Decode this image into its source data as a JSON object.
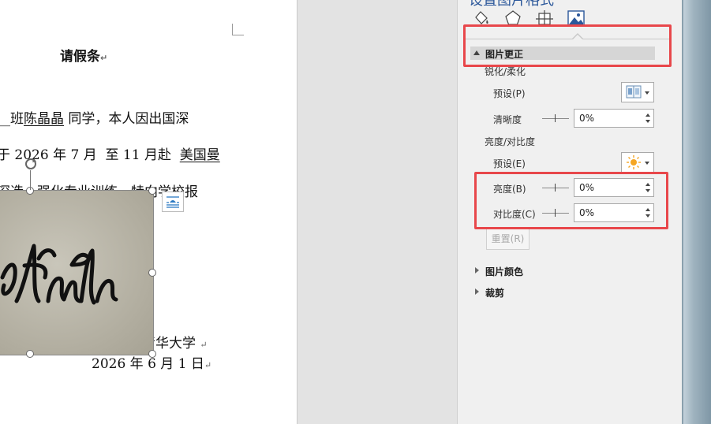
{
  "document": {
    "title": "请假条",
    "line1": {
      "lead": "__班",
      "name": "陈晶晶",
      "rest": "同学，本人因出国深"
    },
    "line2": {
      "prefix": "于 2026 年 7 月  至 11 月赴",
      "place": "美国曼"
    },
    "line3": "深造，强化专业训练，特向学校报",
    "signature_org": "清华大学",
    "date": "2026 年 6 月 1 日"
  },
  "pane": {
    "title": "设置图片格式",
    "tabs": [
      {
        "name": "fill-line",
        "icon": "paint-bucket-icon"
      },
      {
        "name": "effects",
        "icon": "pentagon-icon"
      },
      {
        "name": "layout-properties",
        "icon": "layout-size-icon"
      },
      {
        "name": "picture",
        "icon": "picture-icon",
        "active": true
      }
    ],
    "correction": {
      "header": "图片更正",
      "sharpen_group": "锐化/柔化",
      "sharpen_preset_label": "预设(P)",
      "sharpness_label": "清晰度",
      "sharpness_value": "0%",
      "bc_group": "亮度/对比度",
      "bc_preset_label": "预设(E)",
      "brightness_label": "亮度(B)",
      "brightness_value": "0%",
      "contrast_label": "对比度(C)",
      "contrast_value": "0%",
      "reset_label": "重置(R)"
    },
    "color_section": "图片颜色",
    "crop_section": "裁剪"
  },
  "colors": {
    "highlight": "#e8474b",
    "accent": "#2b579a"
  }
}
